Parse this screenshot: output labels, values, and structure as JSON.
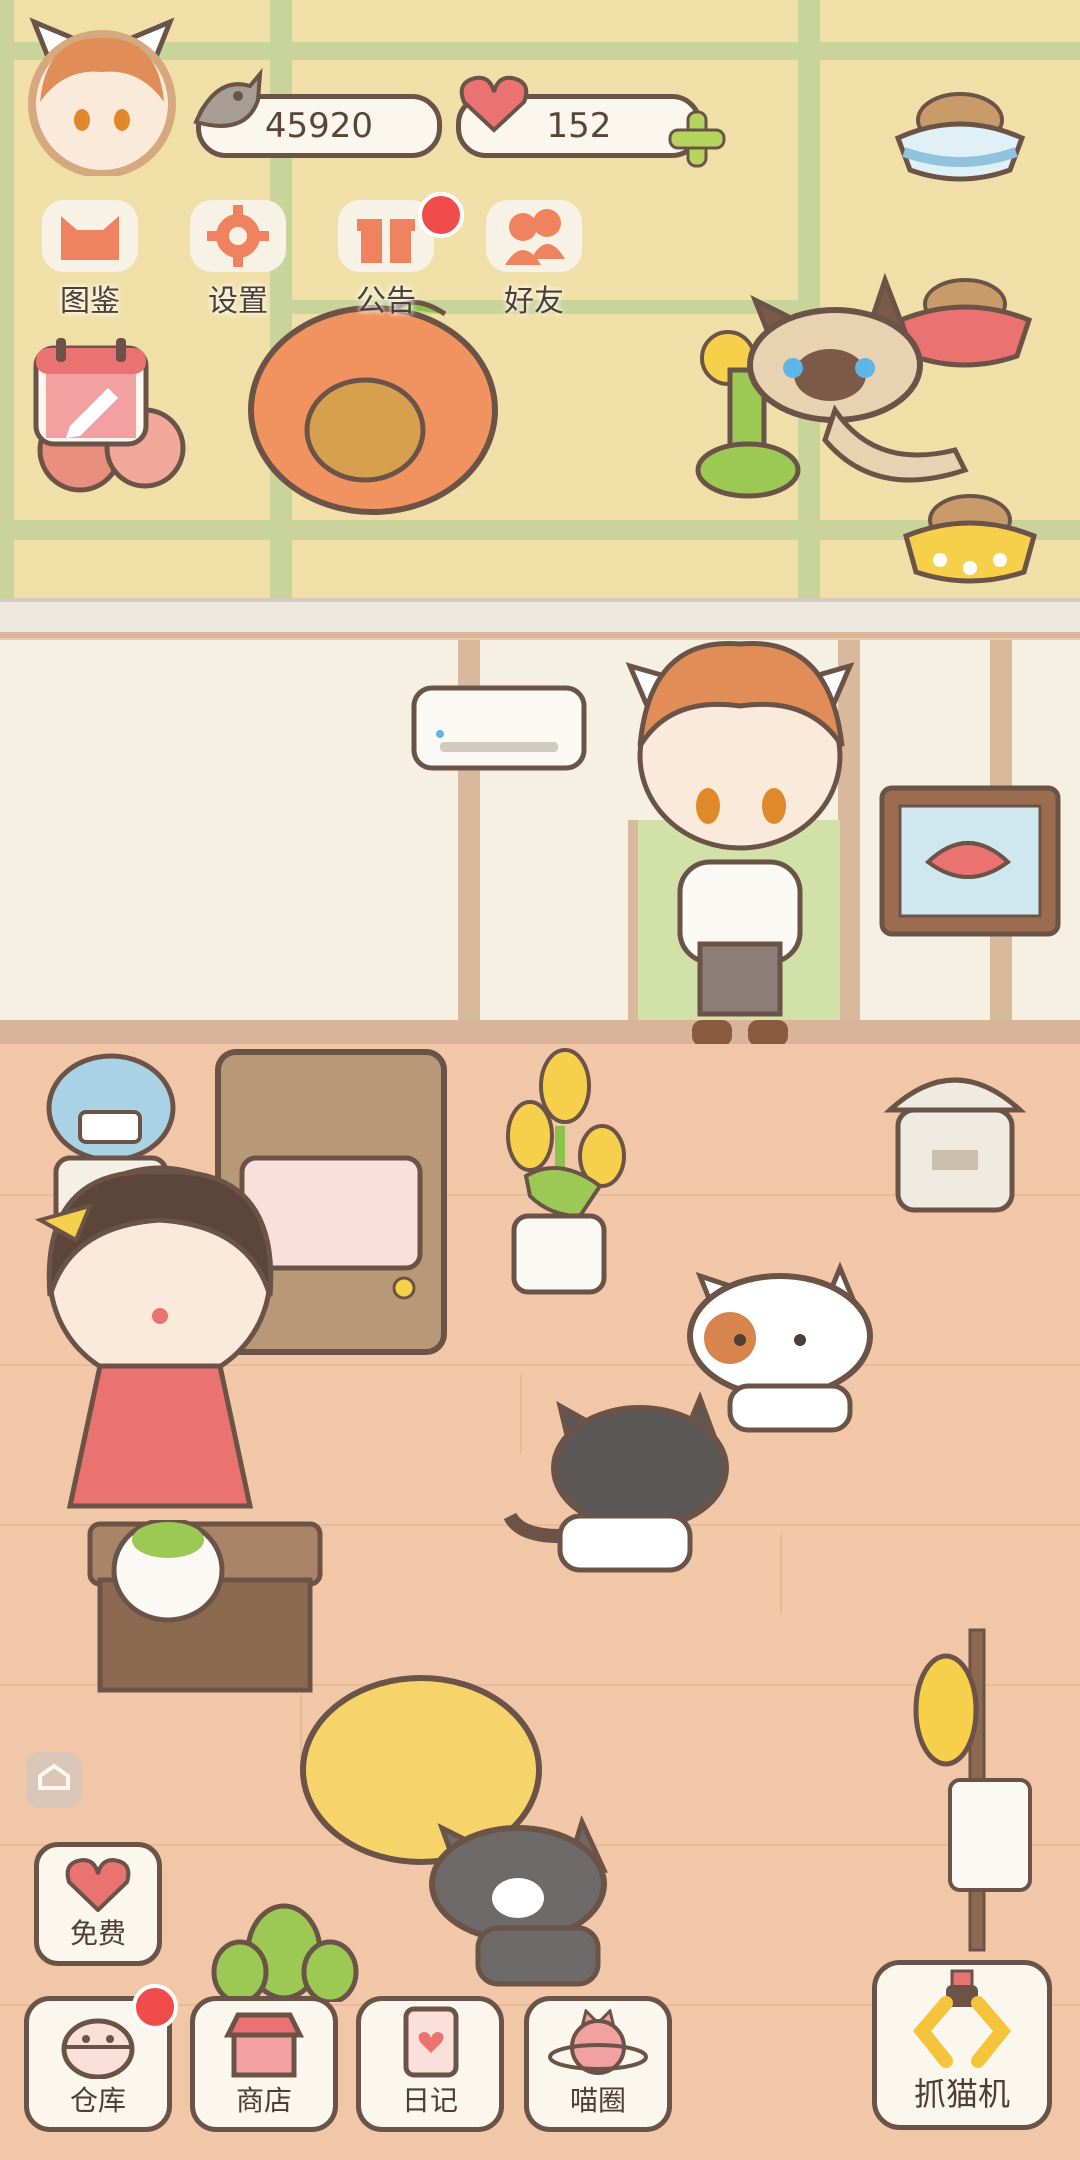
{
  "player": {
    "avatar_icon": "boy-cat-ear-avatar"
  },
  "currency": {
    "fish": {
      "icon": "fish-icon",
      "value": "45920"
    },
    "hearts": {
      "icon": "heart-icon",
      "value": "152",
      "add_icon": "plus-icon"
    }
  },
  "menu": {
    "items": [
      {
        "label": "图鉴",
        "icon": "cat-head-icon"
      },
      {
        "label": "设置",
        "icon": "gear-icon"
      },
      {
        "label": "公告",
        "icon": "gift-icon",
        "badge": true
      },
      {
        "label": "好友",
        "icon": "friends-icon"
      }
    ],
    "calendar_icon": "calendar-pencil-icon"
  },
  "dock": {
    "free": {
      "label": "免费",
      "icon": "heart-icon"
    },
    "items": [
      {
        "label": "仓库",
        "icon": "storage-icon",
        "badge": true
      },
      {
        "label": "商店",
        "icon": "shop-icon"
      },
      {
        "label": "日记",
        "icon": "diary-icon"
      },
      {
        "label": "喵圈",
        "icon": "cat-planet-icon"
      }
    ],
    "claw": {
      "label": "抓猫机",
      "icon": "claw-icon"
    }
  },
  "colors": {
    "outline": "#6b5447",
    "badge": "#f04c4c",
    "accent_orange": "#f0835f",
    "floor": "#f2c7a8",
    "tatami": "#f0e0a8"
  }
}
